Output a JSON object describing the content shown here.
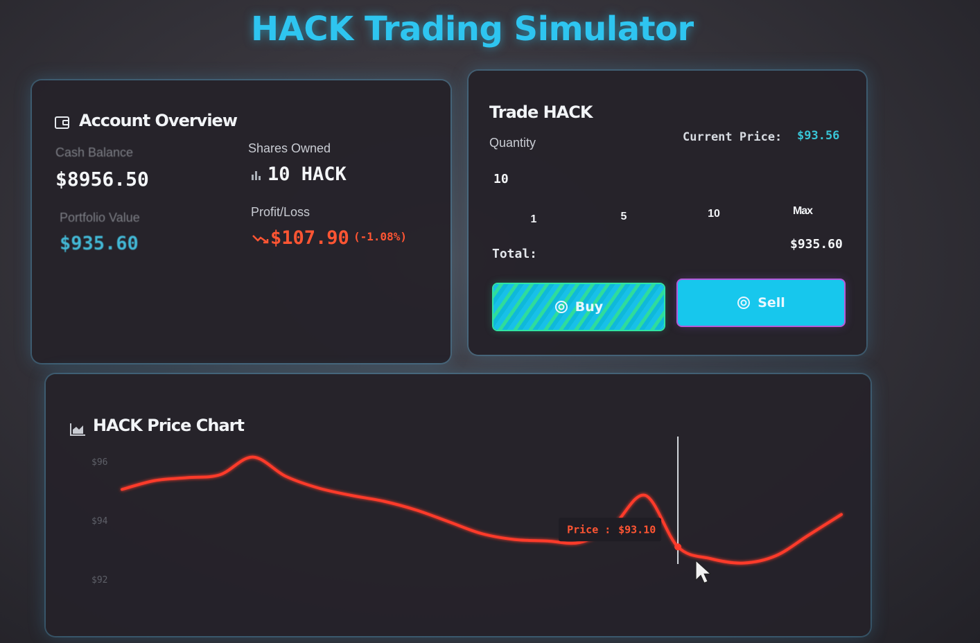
{
  "app": {
    "title": "HACK Trading Simulator"
  },
  "account": {
    "heading": "Account Overview",
    "icon": "wallet-icon",
    "cash_label": "Cash Balance",
    "cash_value": "$8956.50",
    "shares_label": "Shares Owned",
    "shares_icon": "bar-chart-icon",
    "shares_value": "10 HACK",
    "portfolio_label": "Portfolio Value",
    "portfolio_value": "$935.60",
    "pl_label": "Profit/Loss",
    "pl_icon": "trend-down-icon",
    "pl_value": "$107.90",
    "pl_percent": "(-1.08%)"
  },
  "trade": {
    "heading": "Trade HACK",
    "quantity_label": "Quantity",
    "quantity_value": "10",
    "current_price_label": "Current Price:",
    "current_price_value": "$93.56",
    "quick_options": [
      "1",
      "5",
      "10",
      "Max"
    ],
    "total_label": "Total:",
    "total_value": "$935.60",
    "buy_label": "Buy",
    "sell_label": "Sell",
    "button_icon": "coin-icon"
  },
  "chart": {
    "heading": "HACK Price Chart",
    "icon": "area-chart-icon",
    "tooltip_label": "Price :",
    "tooltip_value": "$93.10"
  },
  "colors": {
    "accent": "#2ec5f0",
    "loss": "#ff5533",
    "line": "#ff3b2a",
    "buy": "#2fdc9c",
    "sell_border": "#b65bd9"
  },
  "chart_data": {
    "type": "line",
    "title": "HACK Price Chart",
    "yticks": [
      "$96",
      "$94",
      "$92"
    ],
    "ylim": [
      91.2,
      96.8
    ],
    "series": [
      {
        "values": [
          95.05,
          95.35,
          95.45,
          95.55,
          96.15,
          95.5,
          95.1,
          94.85,
          94.65,
          94.35,
          93.95,
          93.55,
          93.35,
          93.3,
          93.25,
          93.8,
          94.85,
          93.1,
          92.7,
          92.55,
          92.8,
          93.5,
          94.2
        ]
      }
    ],
    "tooltip_index": 17,
    "tooltip_value": 93.1
  }
}
